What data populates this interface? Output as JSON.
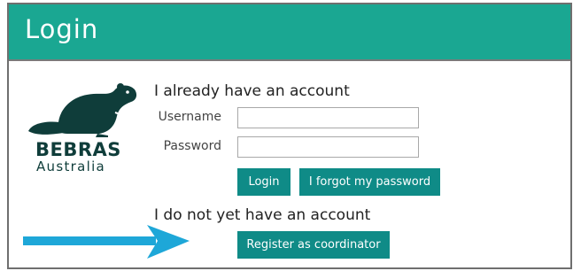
{
  "header": {
    "title": "Login"
  },
  "logo": {
    "name": "BEBRAS",
    "region": "Australia"
  },
  "login": {
    "heading": "I already have an account",
    "username_label": "Username",
    "username_value": "",
    "password_label": "Password",
    "password_value": "",
    "login_button": "Login",
    "forgot_button": "I forgot my password"
  },
  "register": {
    "heading": "I do not yet have an account",
    "register_button": "Register as coordinator"
  },
  "colors": {
    "header_bg": "#1aa792",
    "button_bg": "#0f8b87",
    "arrow": "#1ea7d8",
    "logo": "#0f3d3a"
  },
  "icons": {
    "logo_mark": "beaver-icon",
    "pointer": "arrow-right-icon"
  }
}
